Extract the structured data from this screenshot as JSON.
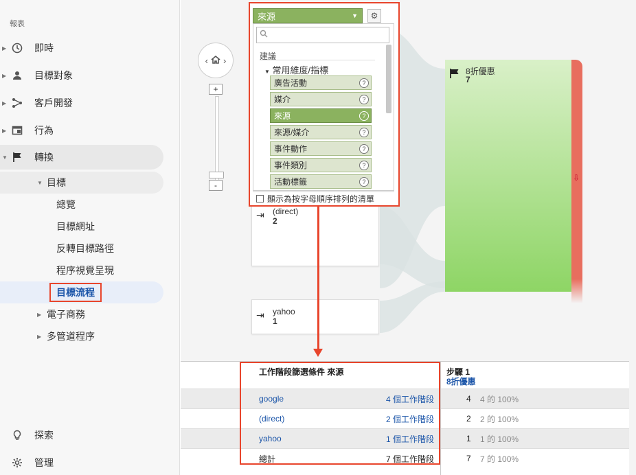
{
  "sidebar": {
    "section_label": "報表",
    "items": [
      {
        "label": "即時",
        "icon": "clock-icon"
      },
      {
        "label": "目標對象",
        "icon": "person-icon"
      },
      {
        "label": "客戶開發",
        "icon": "acquisition-icon"
      },
      {
        "label": "行為",
        "icon": "behavior-icon"
      },
      {
        "label": "轉換",
        "icon": "flag-icon"
      }
    ],
    "goals_label": "目標",
    "goal_items": [
      "總覽",
      "目標網址",
      "反轉目標路徑",
      "程序視覺呈現",
      "目標流程"
    ],
    "ecommerce_label": "電子商務",
    "multichannel_label": "多管道程序",
    "bottom": [
      {
        "label": "探索",
        "icon": "lightbulb-icon"
      },
      {
        "label": "管理",
        "icon": "gear-icon"
      }
    ]
  },
  "zoom": {
    "plus": "+",
    "minus": "-"
  },
  "dropdown": {
    "selected": "來源",
    "suggest_label": "建議",
    "group_label": "常用維度/指標",
    "options": [
      "廣告活動",
      "媒介",
      "來源",
      "來源/媒介",
      "事件動作",
      "事件類別",
      "活動標籤"
    ],
    "selected_index": 2,
    "footer_checkbox": "顯示為按字母順序排列的清單"
  },
  "nodes": [
    {
      "label": "(direct)",
      "count": "2"
    },
    {
      "label": "yahoo",
      "count": "1"
    }
  ],
  "goal": {
    "label": "8折優惠",
    "count": "7"
  },
  "table": {
    "header_source": "工作階段篩選條件 來源",
    "step_title": "步驟 1",
    "step_goal": "8折優惠",
    "rows": [
      {
        "source": "google",
        "sessions": "4 個工作階段",
        "count": "4",
        "pct": "4 的 100%"
      },
      {
        "source": "(direct)",
        "sessions": "2 個工作階段",
        "count": "2",
        "pct": "2 的 100%"
      },
      {
        "source": "yahoo",
        "sessions": "1 個工作階段",
        "count": "1",
        "pct": "1 的 100%"
      },
      {
        "source": "總計",
        "sessions": "7 個工作階段",
        "count": "7",
        "pct": "7 的 100%"
      }
    ]
  },
  "colors": {
    "accent_red": "#e8452c",
    "selected_green": "#8bb25f",
    "link_blue": "#1a54a8"
  }
}
